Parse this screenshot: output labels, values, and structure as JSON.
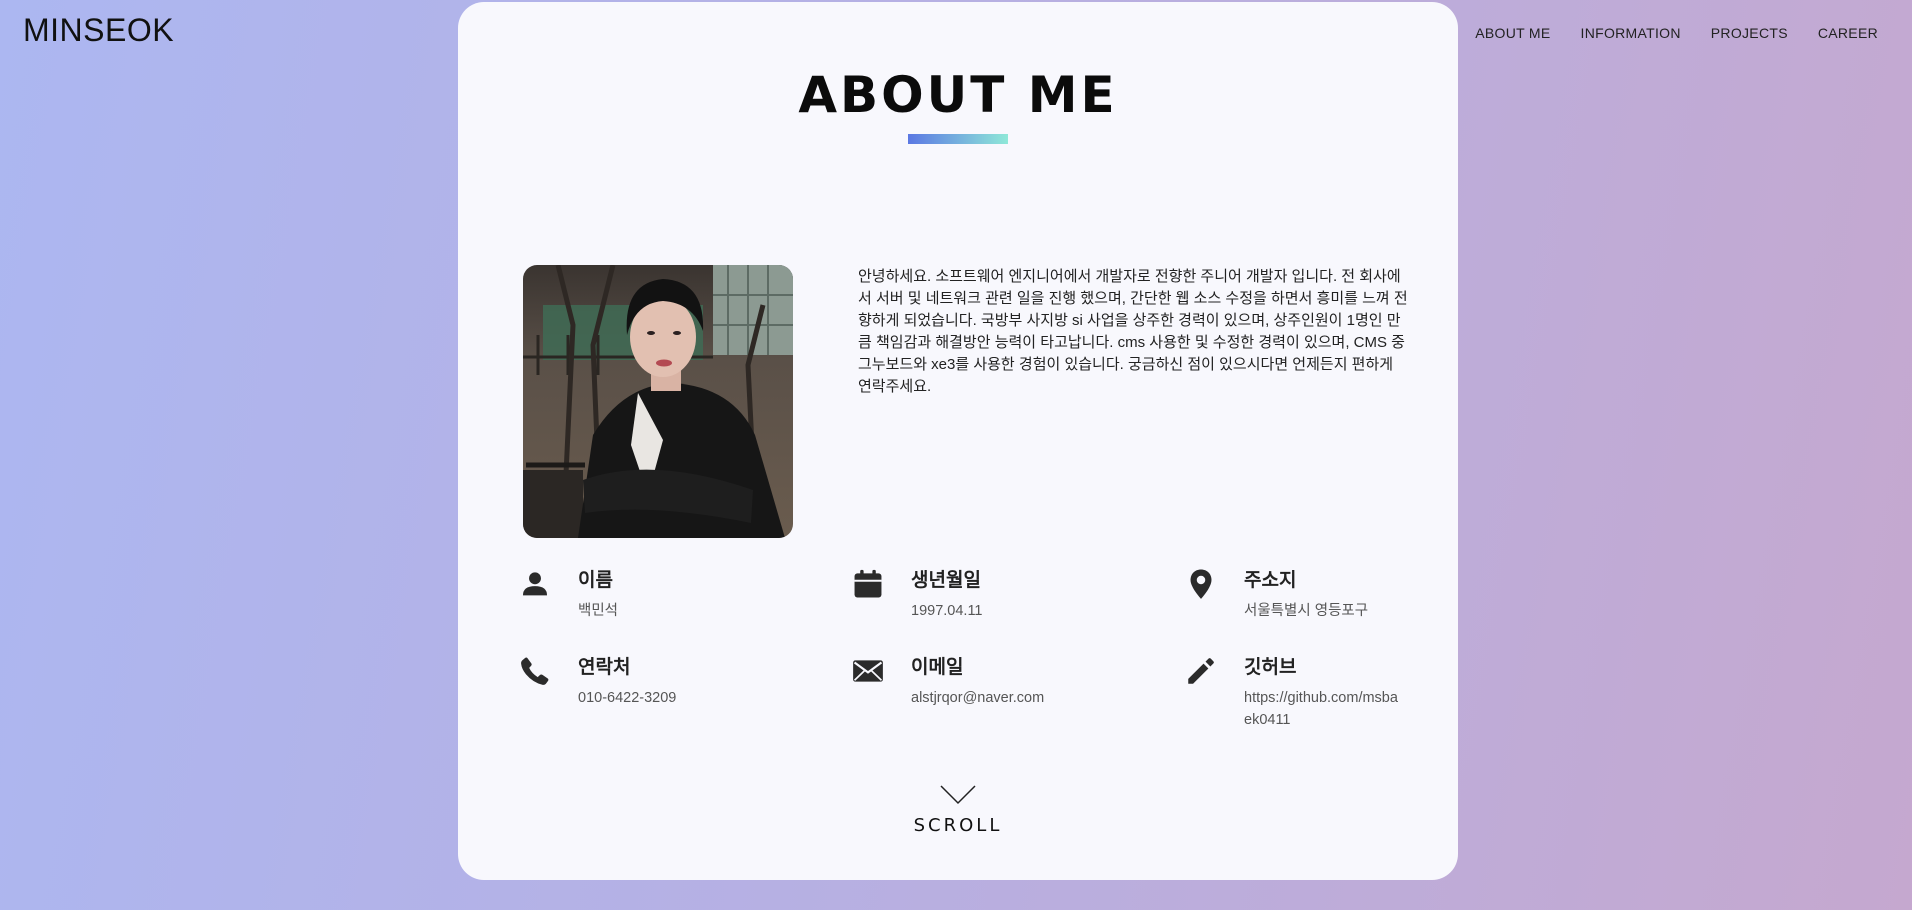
{
  "brand": "MINSEOK",
  "nav": [
    "ABOUT ME",
    "INFORMATION",
    "PROJECTS",
    "CAREER"
  ],
  "section": {
    "title": "ABOUT ME",
    "intro": "안녕하세요. 소프트웨어 엔지니어에서 개발자로 전향한 주니어 개발자 입니다. 전 회사에서 서버 및 네트워크 관련 일을 진행 했으며, 간단한 웹 소스 수정을 하면서 흥미를 느껴 전향하게 되었습니다. 국방부 사지방 si 사업을 상주한 경력이 있으며, 상주인원이 1명인 만큼 책임감과 해결방안 능력이 타고납니다. cms 사용한 및 수정한 경력이 있으며, CMS 중 그누보드와 xe3를 사용한 경험이 있습니다. 궁금하신 점이 있으시다면 언제든지 편하게 연락주세요."
  },
  "info": [
    {
      "icon": "person-icon",
      "label": "이름",
      "value": "백민석"
    },
    {
      "icon": "calendar-icon",
      "label": "생년월일",
      "value": "1997.04.11"
    },
    {
      "icon": "location-pin-icon",
      "label": "주소지",
      "value": "서울특별시 영등포구"
    },
    {
      "icon": "phone-icon",
      "label": "연락처",
      "value": "010-6422-3209"
    },
    {
      "icon": "envelope-icon",
      "label": "이메일",
      "value": "alstjrqor@naver.com"
    },
    {
      "icon": "pencil-icon",
      "label": "깃허브",
      "value": "https://github.com/msbaek0411"
    }
  ],
  "scroll_label": "SCROLL",
  "colors": {
    "accent_start": "#5b78e3",
    "accent_end": "#8fe8d8",
    "card_bg": "#f8f8fd"
  }
}
